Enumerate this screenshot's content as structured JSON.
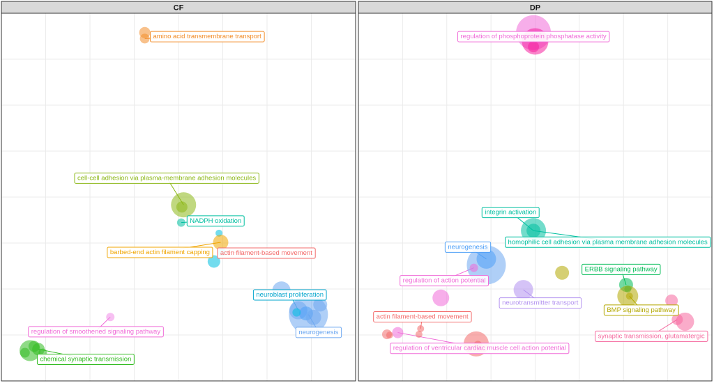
{
  "chart_data": [
    {
      "type": "scatter",
      "facet": "CF",
      "title": "",
      "xlabel": "",
      "ylabel": "",
      "xlim": [
        0,
        1
      ],
      "ylim": [
        0,
        1
      ],
      "grid": true,
      "points": [
        {
          "x": 0.4,
          "y": 0.965,
          "r": 8,
          "color": "#f28e2b"
        },
        {
          "x": 0.4,
          "y": 0.948,
          "r": 7,
          "color": "#f28e2b"
        },
        {
          "x": 0.515,
          "y": 0.478,
          "r": 18,
          "color": "#8cb817"
        },
        {
          "x": 0.51,
          "y": 0.472,
          "r": 8,
          "color": "#8cb817"
        },
        {
          "x": 0.508,
          "y": 0.428,
          "r": 6,
          "color": "#00bfa0"
        },
        {
          "x": 0.62,
          "y": 0.398,
          "r": 5,
          "color": "#00c0e0"
        },
        {
          "x": 0.625,
          "y": 0.372,
          "r": 11,
          "color": "#f0a500"
        },
        {
          "x": 0.628,
          "y": 0.344,
          "r": 6,
          "color": "#00c0e0"
        },
        {
          "x": 0.605,
          "y": 0.318,
          "r": 9,
          "color": "#00c0e0"
        },
        {
          "x": 0.805,
          "y": 0.236,
          "r": 13,
          "color": "#6ea8f0"
        },
        {
          "x": 0.855,
          "y": 0.18,
          "r": 13,
          "color": "#6ea8f0"
        },
        {
          "x": 0.885,
          "y": 0.168,
          "r": 28,
          "color": "#6ea8f0"
        },
        {
          "x": 0.92,
          "y": 0.196,
          "r": 10,
          "color": "#6ea8f0"
        },
        {
          "x": 0.878,
          "y": 0.171,
          "r": 10,
          "color": "#4fa0f8"
        },
        {
          "x": 0.9,
          "y": 0.16,
          "r": 11,
          "color": "#6ea8f0"
        },
        {
          "x": 0.85,
          "y": 0.174,
          "r": 6,
          "color": "#00c0e0"
        },
        {
          "x": 0.298,
          "y": 0.161,
          "r": 6,
          "color": "#f08ce8"
        },
        {
          "x": 0.06,
          "y": 0.066,
          "r": 15,
          "color": "#33bb22"
        },
        {
          "x": 0.085,
          "y": 0.07,
          "r": 9,
          "color": "#33bb22"
        },
        {
          "x": 0.072,
          "y": 0.078,
          "r": 8,
          "color": "#33bb22"
        },
        {
          "x": 0.045,
          "y": 0.06,
          "r": 7,
          "color": "#33bb22"
        },
        {
          "x": 0.098,
          "y": 0.06,
          "r": 6,
          "color": "#33bb22"
        }
      ],
      "labels": [
        {
          "text": "amino acid transmembrane transport",
          "color": "#f28e2b",
          "lx": 0.585,
          "ly": 0.955,
          "px": 0.4,
          "py": 0.948
        },
        {
          "text": "cell-cell adhesion via plasma-membrane adhesion molecules",
          "color": "#8cb817",
          "lx": 0.465,
          "ly": 0.555,
          "px": 0.515,
          "py": 0.478
        },
        {
          "text": "NADPH oxidation",
          "color": "#00bfa0",
          "lx": 0.61,
          "ly": 0.434,
          "px": 0.508,
          "py": 0.428
        },
        {
          "text": "barbed-end actin filament capping",
          "color": "#f0a500",
          "lx": 0.445,
          "ly": 0.345,
          "px": 0.625,
          "py": 0.372
        },
        {
          "text": "actin filament-based movement",
          "color": "#f36b6b",
          "lx": 0.76,
          "ly": 0.343,
          "px": 0.628,
          "py": 0.344
        },
        {
          "text": "neuroblast proliferation",
          "color": "#00a5cc",
          "lx": 0.83,
          "ly": 0.225,
          "px": 0.855,
          "py": 0.18
        },
        {
          "text": "neurogenesis",
          "color": "#6ea8f0",
          "lx": 0.915,
          "ly": 0.119,
          "px": 0.885,
          "py": 0.168
        },
        {
          "text": "regulation of smoothened signaling pathway",
          "color": "#f06cd8",
          "lx": 0.255,
          "ly": 0.121,
          "px": 0.298,
          "py": 0.161
        },
        {
          "text": "chemical synaptic transmission",
          "color": "#33bb22",
          "lx": 0.225,
          "ly": 0.043,
          "px": 0.085,
          "py": 0.07
        }
      ]
    },
    {
      "type": "scatter",
      "facet": "DP",
      "title": "",
      "xlabel": "",
      "ylabel": "",
      "xlim": [
        0,
        1
      ],
      "ylim": [
        0,
        1
      ],
      "grid": true,
      "points": [
        {
          "x": 0.495,
          "y": 0.965,
          "r": 25,
          "color": "#f06cd8"
        },
        {
          "x": 0.5,
          "y": 0.94,
          "r": 19,
          "color": "#f5209e"
        },
        {
          "x": 0.495,
          "y": 0.925,
          "r": 8,
          "color": "#f5209e"
        },
        {
          "x": 0.495,
          "y": 0.405,
          "r": 18,
          "color": "#00bfa0"
        },
        {
          "x": 0.495,
          "y": 0.405,
          "r": 10,
          "color": "#00bfa0"
        },
        {
          "x": 0.355,
          "y": 0.308,
          "r": 28,
          "color": "#6ea8f0"
        },
        {
          "x": 0.355,
          "y": 0.325,
          "r": 14,
          "color": "#4fa0f8"
        },
        {
          "x": 0.318,
          "y": 0.3,
          "r": 6,
          "color": "#f06cd8"
        },
        {
          "x": 0.58,
          "y": 0.286,
          "r": 10,
          "color": "#b3a800"
        },
        {
          "x": 0.465,
          "y": 0.238,
          "r": 14,
          "color": "#b392f0"
        },
        {
          "x": 0.22,
          "y": 0.215,
          "r": 12,
          "color": "#f06cd8"
        },
        {
          "x": 0.77,
          "y": 0.252,
          "r": 10,
          "color": "#00bb55"
        },
        {
          "x": 0.775,
          "y": 0.24,
          "r": 5,
          "color": "#00bb55"
        },
        {
          "x": 0.775,
          "y": 0.22,
          "r": 15,
          "color": "#b3a800"
        },
        {
          "x": 0.78,
          "y": 0.22,
          "r": 5,
          "color": "#b3a800"
        },
        {
          "x": 0.905,
          "y": 0.207,
          "r": 9,
          "color": "#f5689e"
        },
        {
          "x": 0.945,
          "y": 0.148,
          "r": 13,
          "color": "#f5689e"
        },
        {
          "x": 0.922,
          "y": 0.154,
          "r": 8,
          "color": "#f5689e"
        },
        {
          "x": 0.16,
          "y": 0.128,
          "r": 5,
          "color": "#f36b6b"
        },
        {
          "x": 0.155,
          "y": 0.112,
          "r": 5,
          "color": "#f36b6b"
        },
        {
          "x": 0.092,
          "y": 0.117,
          "r": 8,
          "color": "#f06cd8"
        },
        {
          "x": 0.06,
          "y": 0.112,
          "r": 7,
          "color": "#f36b6b"
        },
        {
          "x": 0.068,
          "y": 0.11,
          "r": 5,
          "color": "#f36b6b"
        },
        {
          "x": 0.325,
          "y": 0.085,
          "r": 18,
          "color": "#f36b6b"
        },
        {
          "x": 0.33,
          "y": 0.082,
          "r": 6,
          "color": "#f36b6b"
        }
      ],
      "labels": [
        {
          "text": "regulation of phosphoprotein phosphatase activity",
          "color": "#f06cd8",
          "lx": 0.495,
          "ly": 0.955,
          "px": 0.495,
          "py": 0.94
        },
        {
          "text": "integrin activation",
          "color": "#00bfa0",
          "lx": 0.427,
          "ly": 0.458,
          "px": 0.495,
          "py": 0.405
        },
        {
          "text": "homophilic cell adhesion via plasma membrane adhesion molecules",
          "color": "#00bfa0",
          "lx": 0.735,
          "ly": 0.374,
          "px": 0.495,
          "py": 0.405
        },
        {
          "text": "neurogenesis",
          "color": "#4fa0f8",
          "lx": 0.3,
          "ly": 0.36,
          "px": 0.355,
          "py": 0.325
        },
        {
          "text": "regulation of action potential",
          "color": "#f06cd8",
          "lx": 0.23,
          "ly": 0.265,
          "px": 0.318,
          "py": 0.3
        },
        {
          "text": "ERBB signaling pathway",
          "color": "#00bb55",
          "lx": 0.755,
          "ly": 0.297,
          "px": 0.77,
          "py": 0.252
        },
        {
          "text": "neurotransmitter transport",
          "color": "#b392f0",
          "lx": 0.515,
          "ly": 0.202,
          "px": 0.465,
          "py": 0.238
        },
        {
          "text": "BMP signaling pathway",
          "color": "#b3a800",
          "lx": 0.815,
          "ly": 0.182,
          "px": 0.78,
          "py": 0.22
        },
        {
          "text": "synaptic transmission, glutamatergic",
          "color": "#f5689e",
          "lx": 0.845,
          "ly": 0.108,
          "px": 0.922,
          "py": 0.154
        },
        {
          "text": "actin filament-based movement",
          "color": "#f36b6b",
          "lx": 0.165,
          "ly": 0.163,
          "px": 0.16,
          "py": 0.128
        },
        {
          "text": "regulation of ventricular cardiac muscle cell action potential",
          "color": "#f06cd8",
          "lx": 0.335,
          "ly": 0.074,
          "px": 0.092,
          "py": 0.117
        }
      ]
    }
  ]
}
